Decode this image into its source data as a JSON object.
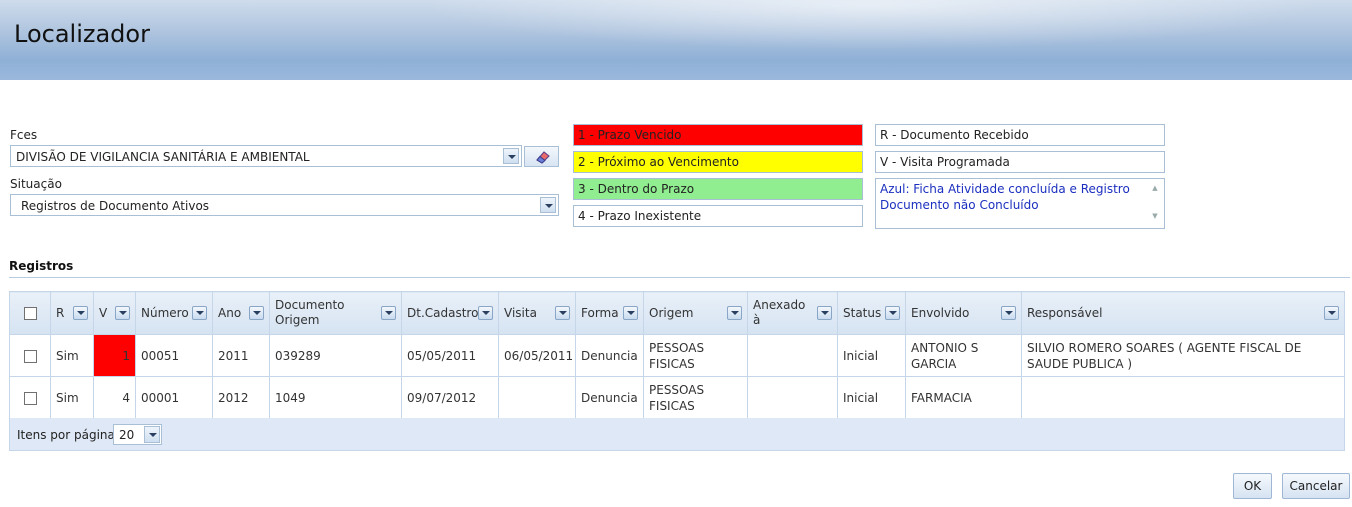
{
  "header": {
    "title": "Localizador"
  },
  "filters": {
    "fces_label": "Fces",
    "fces_value": "DIVISÃO DE VIGILANCIA SANITÁRIA E AMBIENTAL",
    "situacao_label": "Situação",
    "situacao_value": "Registros de Documento Ativos"
  },
  "legend": {
    "prazo": [
      {
        "text": "1 - Prazo Vencido",
        "color": "#ff0000"
      },
      {
        "text": "2 - Próximo ao Vencimento",
        "color": "#ffff00"
      },
      {
        "text": "3 - Dentro do Prazo",
        "color": "#90ee90"
      },
      {
        "text": "4 - Prazo Inexistente",
        "color": "#ffffff"
      }
    ],
    "codes": [
      {
        "text": "R - Documento Recebido"
      },
      {
        "text": "V - Visita Programada"
      }
    ],
    "note": "Azul: Ficha Atividade concluída e Registro Documento não Concluído"
  },
  "registros": {
    "title": "Registros",
    "columns": [
      "R",
      "V",
      "Número",
      "Ano",
      "Documento Origem",
      "Dt.Cadastro",
      "Visita",
      "Forma",
      "Origem",
      "Anexado à",
      "Status",
      "Envolvido",
      "Responsável"
    ],
    "rows": [
      {
        "r": "Sim",
        "v": "1",
        "numero": "00051",
        "ano": "2011",
        "doc_origem": "039289",
        "dt_cadastro": "05/05/2011",
        "visita": "06/05/2011",
        "forma": "Denuncia",
        "origem": "PESSOAS FISICAS",
        "anexado": "",
        "status": "Inicial",
        "envolvido": "ANTONIO S GARCIA",
        "responsavel": "SILVIO ROMERO SOARES ( AGENTE FISCAL DE SAUDE PUBLICA )",
        "v_color": "#ff0000"
      },
      {
        "r": "Sim",
        "v": "4",
        "numero": "00001",
        "ano": "2012",
        "doc_origem": "1049",
        "dt_cadastro": "09/07/2012",
        "visita": "",
        "forma": "Denuncia",
        "origem": "PESSOAS FISICAS",
        "anexado": "",
        "status": "Inicial",
        "envolvido": "FARMACIA",
        "responsavel": ""
      }
    ],
    "pager": {
      "label": "Itens por página:",
      "value": "20"
    }
  },
  "actions": {
    "ok": "OK",
    "cancel": "Cancelar"
  }
}
